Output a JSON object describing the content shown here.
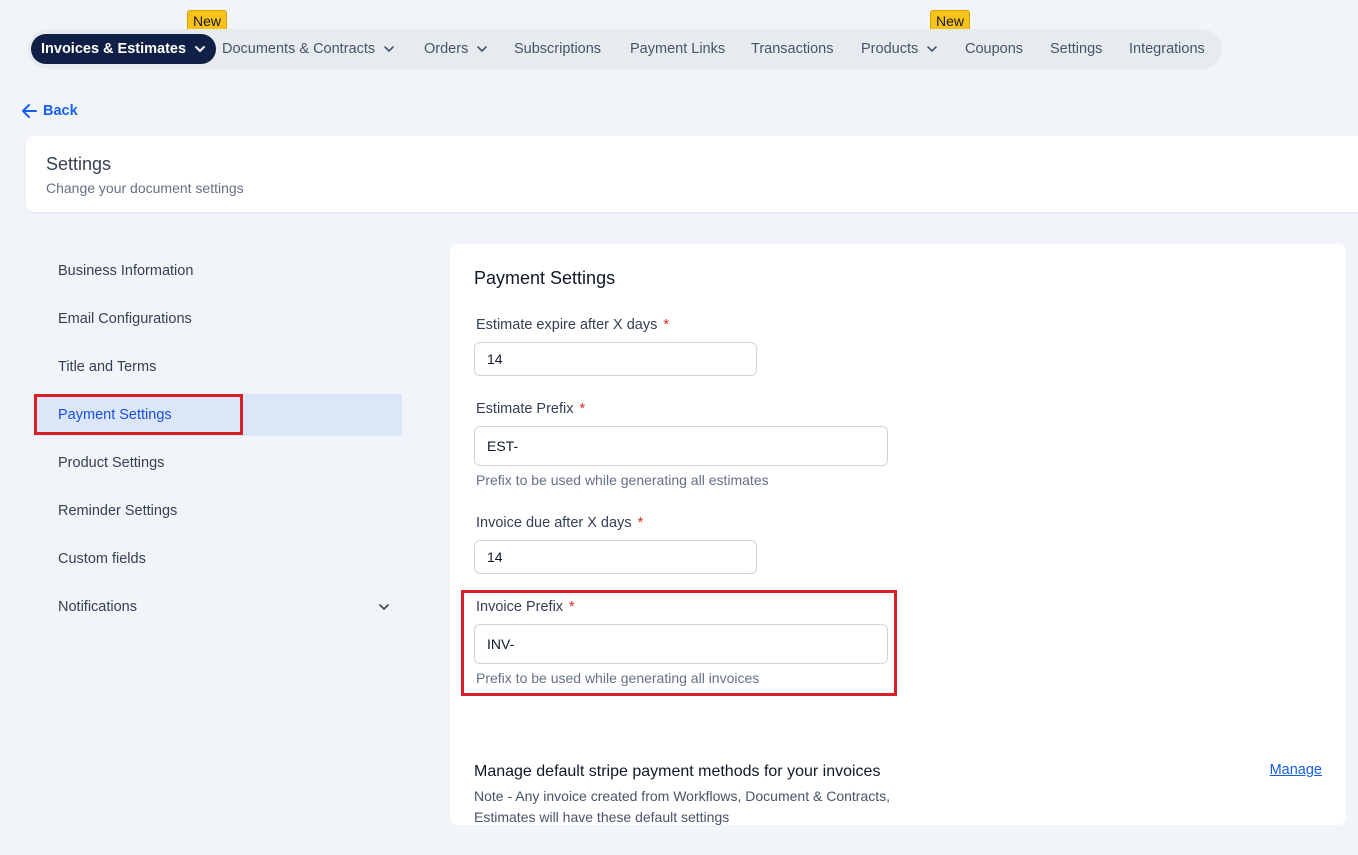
{
  "nav": {
    "items": [
      {
        "label": "Invoices & Estimates",
        "dropdown": true,
        "active": true
      },
      {
        "label": "Documents & Contracts",
        "dropdown": true
      },
      {
        "label": "Orders",
        "dropdown": true
      },
      {
        "label": "Subscriptions"
      },
      {
        "label": "Payment Links"
      },
      {
        "label": "Transactions"
      },
      {
        "label": "Products",
        "dropdown": true
      },
      {
        "label": "Coupons"
      },
      {
        "label": "Settings"
      },
      {
        "label": "Integrations"
      }
    ],
    "badge_label": "New"
  },
  "back_label": "Back",
  "header": {
    "title": "Settings",
    "subtitle": "Change your document settings"
  },
  "sidebar": {
    "items": [
      {
        "label": "Business Information"
      },
      {
        "label": "Email Configurations"
      },
      {
        "label": "Title and Terms"
      },
      {
        "label": "Payment Settings",
        "active": true
      },
      {
        "label": "Product Settings"
      },
      {
        "label": "Reminder Settings"
      },
      {
        "label": "Custom fields"
      },
      {
        "label": "Notifications",
        "expandable": true
      }
    ]
  },
  "main": {
    "title": "Payment Settings",
    "required_mark": "*",
    "fields": {
      "estimate_expire": {
        "label": "Estimate expire after X days",
        "value": "14"
      },
      "estimate_prefix": {
        "label": "Estimate Prefix",
        "value": "EST-",
        "help": "Prefix to be used while generating all estimates"
      },
      "invoice_due": {
        "label": "Invoice due after X days",
        "value": "14"
      },
      "invoice_prefix": {
        "label": "Invoice Prefix",
        "value": "INV-",
        "help": "Prefix to be used while generating all invoices"
      }
    },
    "stripe": {
      "title": "Manage default stripe payment methods for your invoices",
      "note": "Note - Any invoice created from Workflows, Document & Contracts, Estimates will have these default settings",
      "manage_label": "Manage"
    }
  },
  "colors": {
    "accent": "#155eef",
    "nav_active_bg": "#101f45",
    "badge_bg": "#f7c21a",
    "highlight_box": "#dc1f26"
  }
}
